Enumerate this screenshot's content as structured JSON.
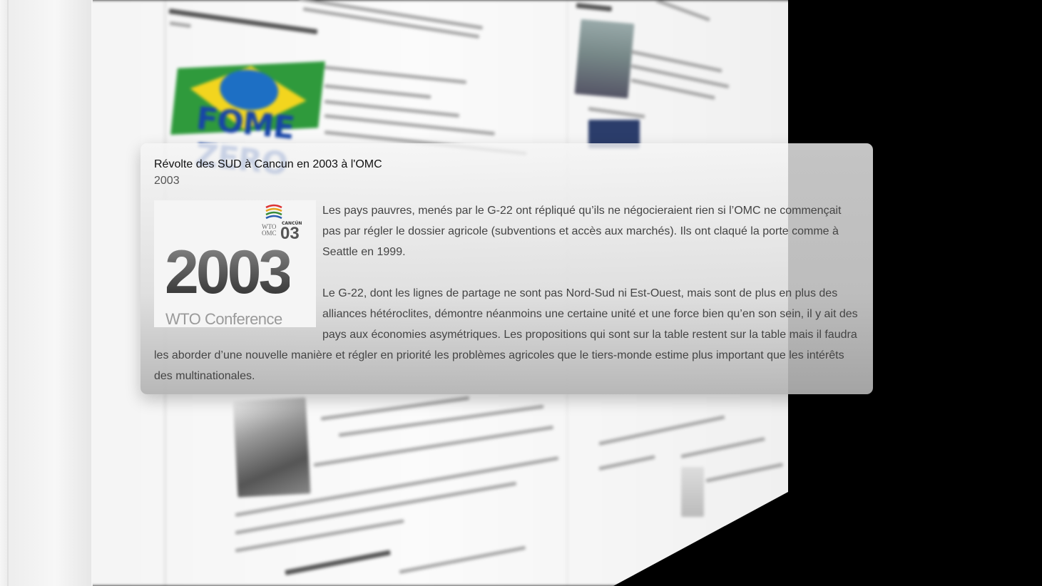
{
  "card": {
    "title": "Révolte des SUD à Cancun en 2003 à l'OMC",
    "date": "2003",
    "image": {
      "year": "2003",
      "caption": "WTO Conference",
      "logo_line1": "WTO",
      "logo_line2": "OMC",
      "logo_place": "CANCÚN",
      "logo_year": "03"
    },
    "paragraphs": [
      "Les pays pauvres, menés par le G-22 ont répliqué qu’ils ne négocieraient rien si l’OMC ne commençait pas par régler le dossier agricole (subventions et accès aux marchés). Ils ont claqué la porte comme à Seattle en 1999.",
      "Le G-22, dont les lignes de partage ne sont pas Nord-Sud ni Est-Ouest, mais sont de plus en plus des alliances hétéroclites, démontre néanmoins une certaine unité et une force bien qu’en son sein, il y ait des pays aux économies asymétriques. Les propositions qui sont sur la table restent sur la table mais il faudra les aborder d’une nouvelle manière et régler en priorité les problèmes agricoles que le tiers-monde estime plus important que les intérêts des multinationales."
    ]
  },
  "background": {
    "flag_text": "FOME ZERO"
  },
  "colors": {
    "card_top": "#f5f5f5",
    "card_bottom": "#b2b2b2",
    "backdrop": "#000000"
  }
}
